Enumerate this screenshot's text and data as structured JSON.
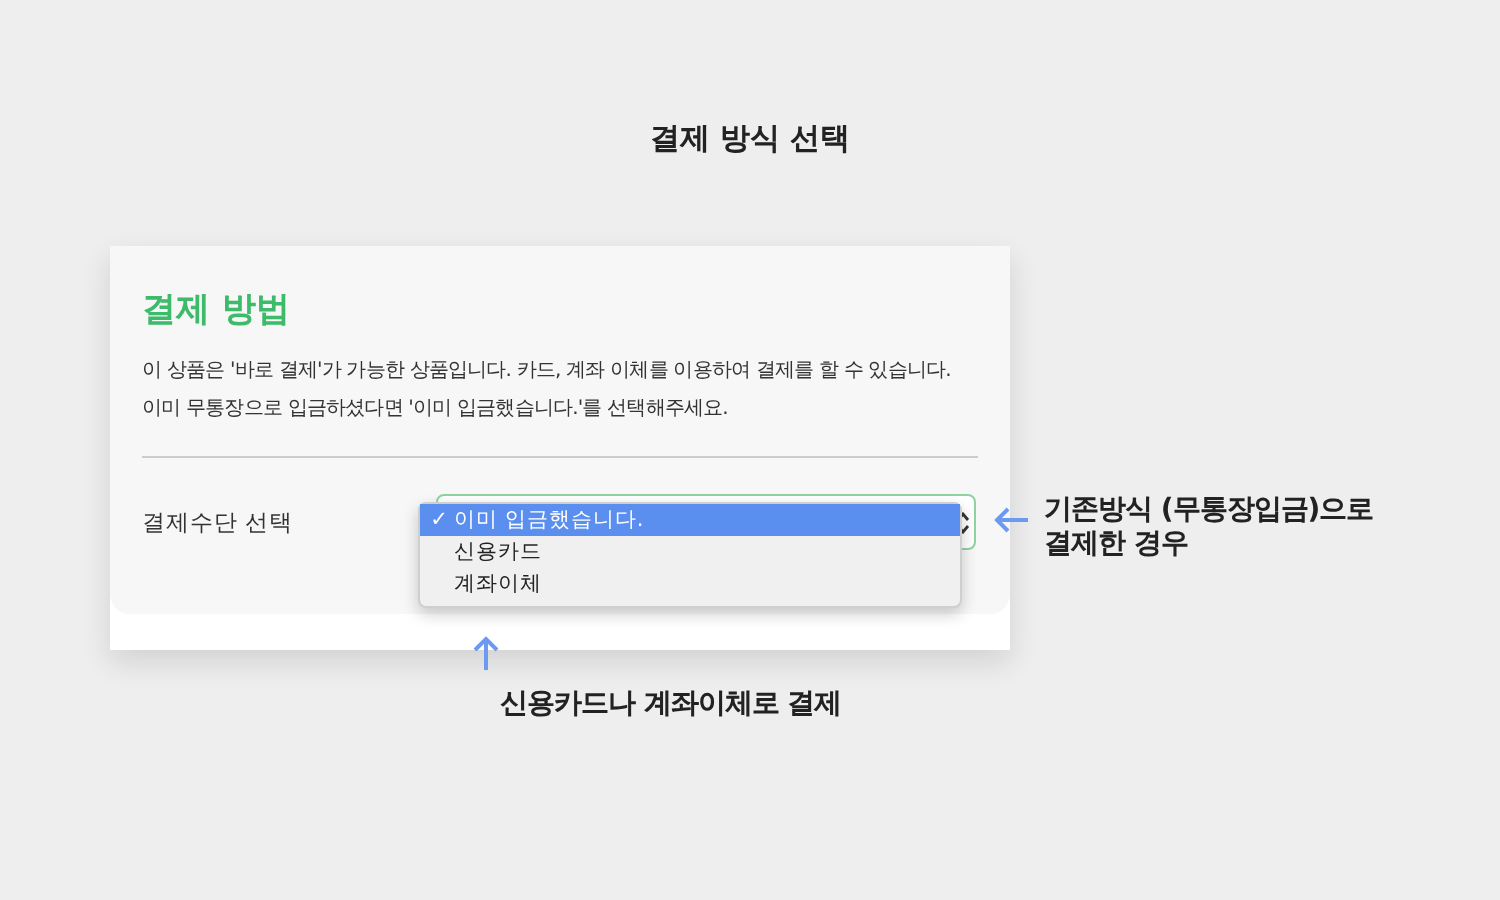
{
  "title": "결제 방식 선택",
  "card": {
    "heading": "결제 방법",
    "description": [
      "이 상품은 '바로 결제'가 가능한 상품입니다. 카드, 계좌 이체를 이용하여 결제를 할 수 있습니다.",
      "이미 무통장으로 입금하셨다면 '이미 입금했습니다.'를 선택해주세요."
    ],
    "field_label": "결제수단 선택",
    "check_mark": "✓",
    "options": [
      {
        "label": "이미 입금했습니다.",
        "selected": true
      },
      {
        "label": "신용카드",
        "selected": false
      },
      {
        "label": "계좌이체",
        "selected": false
      }
    ]
  },
  "annotations": {
    "right": [
      "기존방식 (무통장입금)으로",
      "결제한 경우"
    ],
    "bottom": "신용카드나 계좌이체로 결제"
  }
}
